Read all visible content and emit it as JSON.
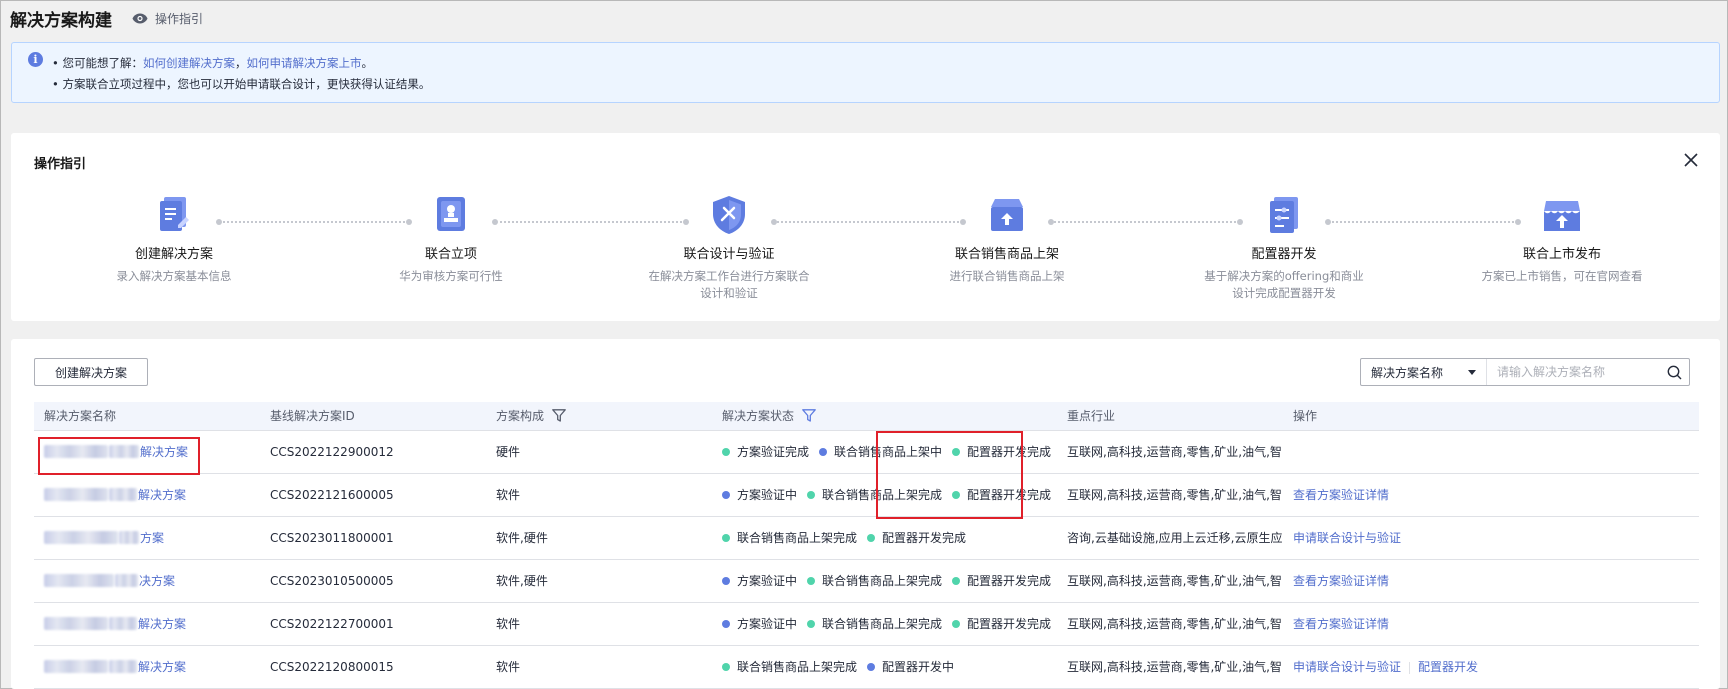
{
  "header": {
    "title": "解决方案构建",
    "guide_label": "操作指引"
  },
  "banner": {
    "line1_prefix": "• 您可能想了解：",
    "link1": "如何创建解决方案",
    "separator": "，",
    "link2": "如何申请解决方案上市",
    "line1_suffix": "。",
    "line2": "• 方案联合立项过程中，您也可以开始申请联合设计，更快获得认证结果。"
  },
  "guide": {
    "title": "操作指引",
    "steps": [
      {
        "name": "创建解决方案",
        "desc": "录入解决方案基本信息",
        "desc2": "",
        "icon": "document-edit-icon"
      },
      {
        "name": "联合立项",
        "desc": "华为审核方案可行性",
        "desc2": "",
        "icon": "stamp-icon"
      },
      {
        "name": "联合设计与验证",
        "desc": "在解决方案工作台进行方案联合",
        "desc2": "设计和验证",
        "icon": "shield-tools-icon"
      },
      {
        "name": "联合销售商品上架",
        "desc": "进行联合销售商品上架",
        "desc2": "",
        "icon": "box-upload-icon"
      },
      {
        "name": "配置器开发",
        "desc": "基于解决方案的offering和商业",
        "desc2": "设计完成配置器开发",
        "icon": "configurator-icon"
      },
      {
        "name": "联合上市发布",
        "desc": "方案已上市销售，可在官网查看",
        "desc2": "",
        "icon": "shop-upload-icon"
      }
    ]
  },
  "list": {
    "create_button": "创建解决方案",
    "search_field": "解决方案名称",
    "search_placeholder": "请输入解决方案名称",
    "columns": [
      "解决方案名称",
      "基线解决方案ID",
      "方案构成",
      "解决方案状态",
      "重点行业",
      "操作"
    ],
    "rows": [
      {
        "name": "解决方案",
        "id": "CCS2022122900012",
        "composition": "硬件",
        "statuses": [
          {
            "label": "方案验证完成",
            "color": "#50d4ab"
          },
          {
            "label": "联合销售商品上架中",
            "color": "#5e7ce0"
          },
          {
            "label": "配置器开发完成",
            "color": "#50d4ab"
          }
        ],
        "industry": "互联网,高科技,运营商,零售,矿业,油气,智...",
        "actions": []
      },
      {
        "name": "解决方案",
        "id": "CCS2022121600005",
        "composition": "软件",
        "statuses": [
          {
            "label": "方案验证中",
            "color": "#5e7ce0"
          },
          {
            "label": "联合销售商品上架完成",
            "color": "#50d4ab"
          },
          {
            "label": "配置器开发完成",
            "color": "#50d4ab"
          }
        ],
        "industry": "互联网,高科技,运营商,零售,矿业,油气,智...",
        "actions": [
          "查看方案验证详情"
        ]
      },
      {
        "name": "方案",
        "id": "CCS2023011800001",
        "composition": "软件,硬件",
        "statuses": [
          {
            "label": "联合销售商品上架完成",
            "color": "#50d4ab"
          },
          {
            "label": "配置器开发完成",
            "color": "#50d4ab"
          }
        ],
        "industry": "咨询,云基础设施,应用上云迁移,云原生应...",
        "actions": [
          "申请联合设计与验证"
        ]
      },
      {
        "name": "决方案",
        "id": "CCS2023010500005",
        "composition": "软件,硬件",
        "statuses": [
          {
            "label": "方案验证中",
            "color": "#5e7ce0"
          },
          {
            "label": "联合销售商品上架完成",
            "color": "#50d4ab"
          },
          {
            "label": "配置器开发完成",
            "color": "#50d4ab"
          }
        ],
        "industry": "互联网,高科技,运营商,零售,矿业,油气,智...",
        "actions": [
          "查看方案验证详情"
        ]
      },
      {
        "name": "解决方案",
        "id": "CCS2022122700001",
        "composition": "软件",
        "statuses": [
          {
            "label": "方案验证中",
            "color": "#5e7ce0"
          },
          {
            "label": "联合销售商品上架完成",
            "color": "#50d4ab"
          },
          {
            "label": "配置器开发完成",
            "color": "#50d4ab"
          }
        ],
        "industry": "互联网,高科技,运营商,零售,矿业,油气,智...",
        "actions": [
          "查看方案验证详情"
        ]
      },
      {
        "name": "解决方案",
        "id": "CCS2022120800015",
        "composition": "软件",
        "statuses": [
          {
            "label": "联合销售商品上架完成",
            "color": "#50d4ab"
          },
          {
            "label": "配置器开发中",
            "color": "#5e7ce0"
          }
        ],
        "industry": "互联网,高科技,运营商,零售,矿业,油气,智...",
        "actions": [
          "申请联合设计与验证",
          "配置器开发"
        ]
      }
    ]
  }
}
